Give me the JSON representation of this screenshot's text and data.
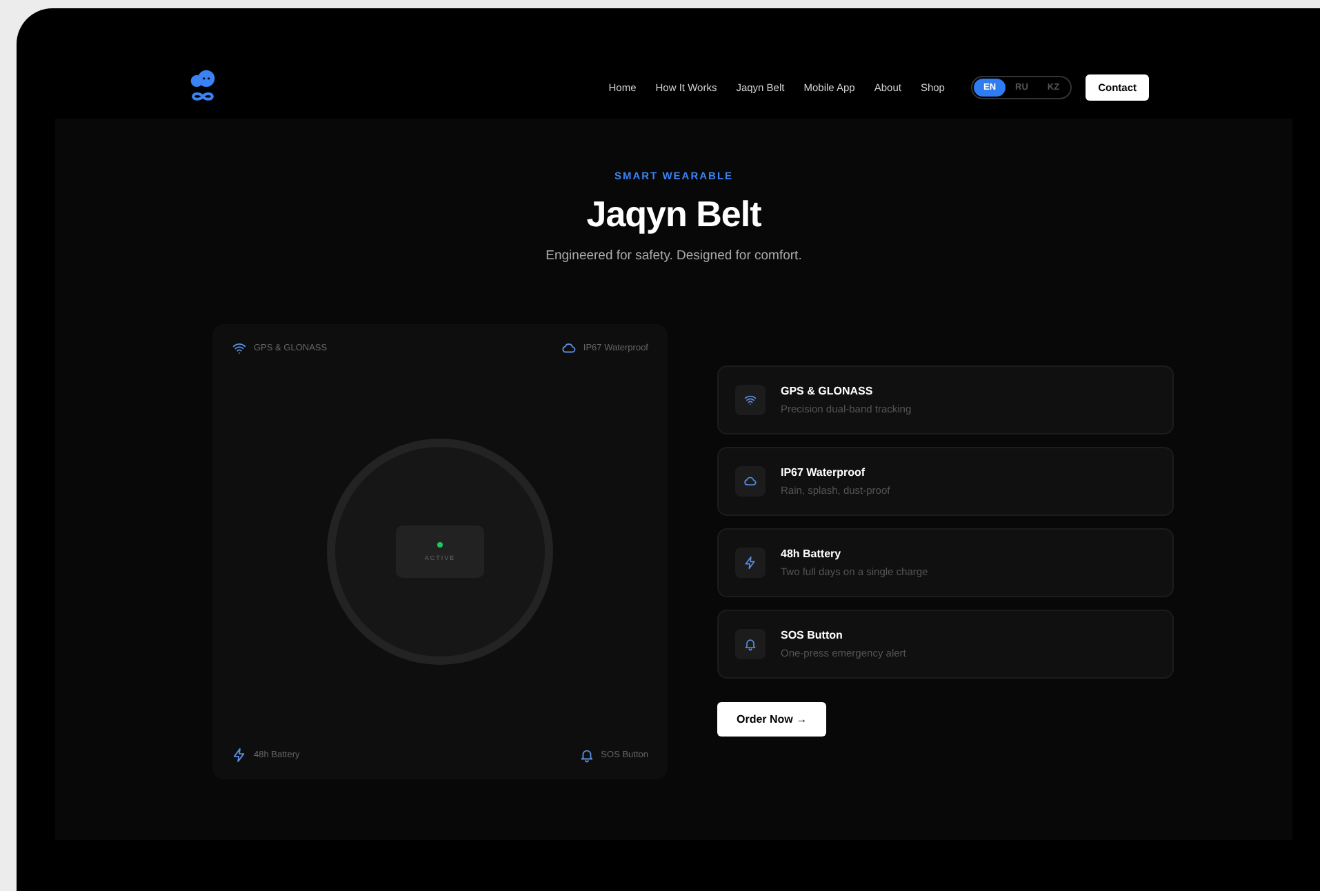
{
  "nav": {
    "links": [
      {
        "label": "Home"
      },
      {
        "label": "How It Works"
      },
      {
        "label": "Jaqyn Belt"
      },
      {
        "label": "Mobile App"
      },
      {
        "label": "About"
      },
      {
        "label": "Shop"
      }
    ],
    "languages": [
      {
        "label": "EN",
        "selected": true
      },
      {
        "label": "RU",
        "selected": false
      },
      {
        "label": "KZ",
        "selected": false
      }
    ],
    "contact_button": "Contact"
  },
  "hero": {
    "eyebrow": "SMART WEARABLE",
    "title": "Jaqyn Belt",
    "subtitle": "Engineered for safety. Designed for comfort."
  },
  "device_panel": {
    "corner_labels": [
      {
        "kind": "wifi",
        "label": "GPS & GLONASS"
      },
      {
        "kind": "cloud",
        "label": "IP67 Waterproof"
      },
      {
        "kind": "bolt",
        "label": "48h Battery"
      },
      {
        "kind": "bell",
        "label": "SOS Button"
      }
    ],
    "status": {
      "label": "ACTIVE",
      "color": "#22c55e"
    }
  },
  "features": [
    {
      "kind": "wifi",
      "title": "GPS & GLONASS",
      "description": "Precision dual-band tracking"
    },
    {
      "kind": "cloud",
      "title": "IP67 Waterproof",
      "description": "Rain, splash, dust-proof"
    },
    {
      "kind": "bolt",
      "title": "48h Battery",
      "description": "Two full days on a single charge"
    },
    {
      "kind": "bell",
      "title": "SOS Button",
      "description": "One-press emergency alert"
    }
  ],
  "order_button": {
    "label": "Order Now",
    "arrow": "→"
  }
}
